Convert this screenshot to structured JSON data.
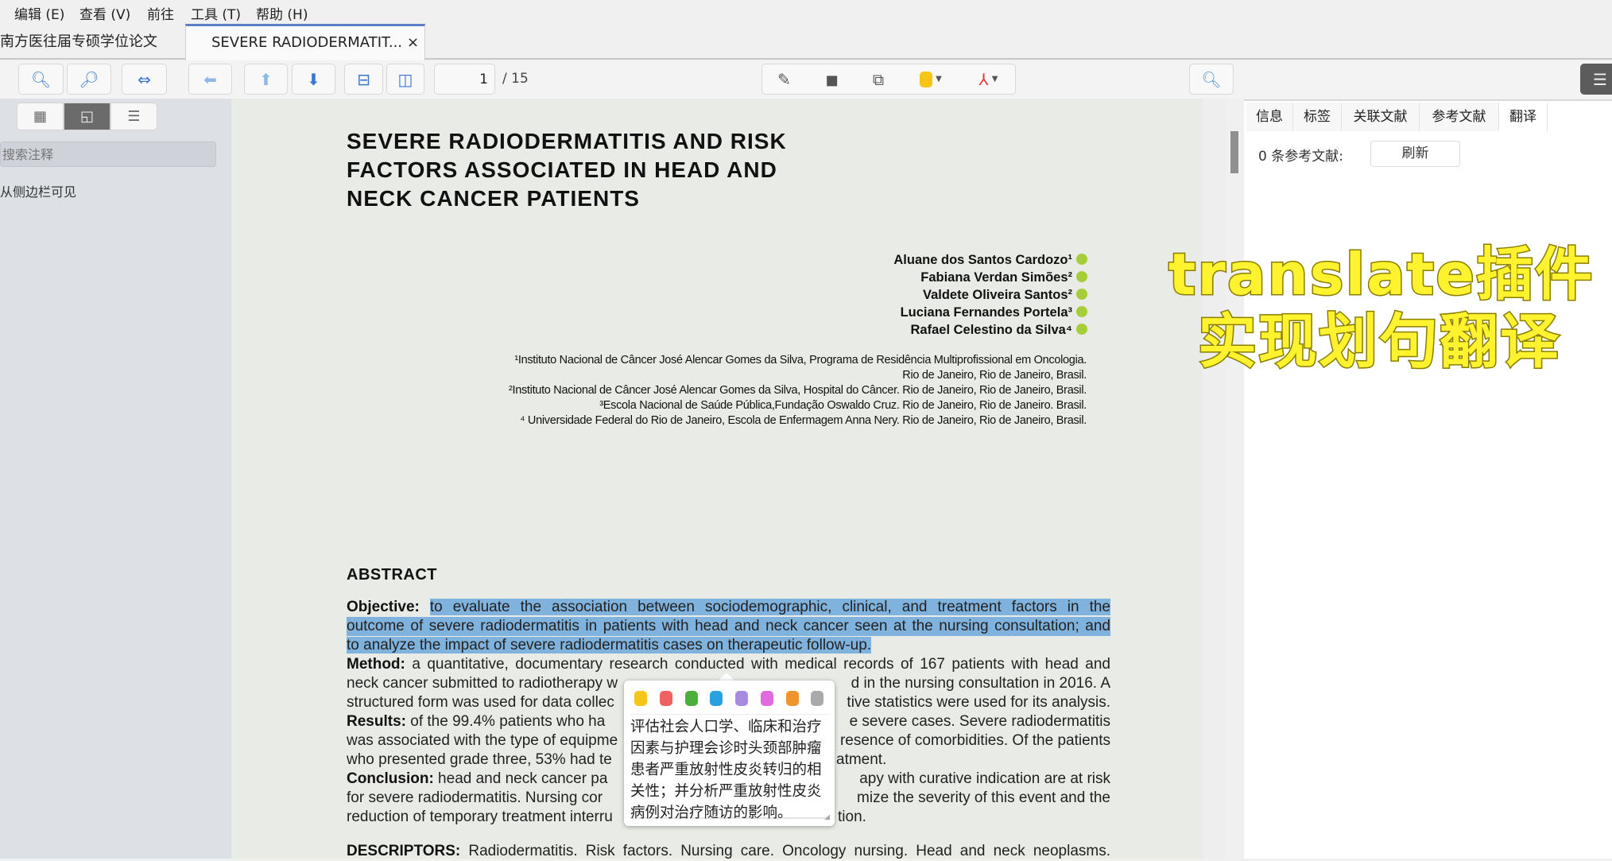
{
  "menubar": {
    "items": [
      "编辑 (E)",
      "查看 (V)",
      "前往",
      "工具 (T)",
      "帮助 (H)"
    ]
  },
  "tabs": [
    {
      "label": "南方医往届专硕学位论文"
    },
    {
      "label": "SEVERE RADIODERMATIT...",
      "close": "×"
    }
  ],
  "toolbar": {
    "page_current": "1",
    "page_total": "/ 15",
    "highlight_color": "#f5c518"
  },
  "sidebar": {
    "search_placeholder": "搜索注释",
    "note": "从侧边栏可见"
  },
  "right_panel": {
    "tabs": [
      "信息",
      "标签",
      "关联文献",
      "参考文献",
      "翻译"
    ],
    "ref_count": "0 条参考文献:",
    "refresh": "刷新"
  },
  "document": {
    "title_lines": [
      "SEVERE RADIODERMATITIS AND RISK",
      "FACTORS ASSOCIATED IN HEAD AND",
      "NECK CANCER PATIENTS"
    ],
    "authors": [
      "Aluane dos Santos Cardozo¹",
      "Fabiana Verdan Simões²",
      "Valdete Oliveira Santos²",
      "Luciana Fernandes Portela³",
      "Rafael Celestino da Silva⁴"
    ],
    "affiliations": [
      "¹Instituto Nacional de Câncer José Alencar Gomes da Silva, Programa de Residência Multiprofissional em Oncologia.",
      "Rio de Janeiro, Rio de Janeiro, Brasil.",
      "²Instituto Nacional de Câncer José Alencar Gomes da Silva, Hospital do Câncer. Rio de Janeiro, Rio de Janeiro, Brasil.",
      "³Escola Nacional de Saúde Pública,Fundação Oswaldo Cruz. Rio de Janeiro, Rio de Janeiro. Brasil.",
      "⁴ Universidade Federal do Rio de Janeiro, Escola de Enfermagem Anna Nery. Rio de Janeiro, Rio de Janeiro, Brasil."
    ],
    "abstract_heading": "ABSTRACT",
    "objective_label": "Objective:",
    "objective_lines": [
      "to evaluate the association between sociodemographic, clinical, and treatment factors in the",
      "outcome of severe radiodermatitis in patients with head and neck cancer seen at the nursing consultation; and",
      "to analyze the impact of severe radiodermatitis cases on therapeutic follow-up."
    ],
    "method_label": "Method:",
    "method_line1": "a quantitative, documentary research conducted with medical records of 167 patients with head and",
    "lines": [
      {
        "left": "neck cancer submitted to radiotherapy w",
        "right": "d in the nursing consultation in 2016. A"
      },
      {
        "left": "structured form was used for data collec",
        "right": "tive statistics were used for its analysis."
      },
      {
        "label": "Results:",
        "left": " of the 99.4% patients who ha",
        "right": "e severe cases. Severe radiodermatitis"
      },
      {
        "left": "was associated with the type of equipme",
        "right": "resence of comorbidities. Of the patients"
      },
      {
        "left": "who presented grade three, 53% had te",
        "right": "atment."
      },
      {
        "label": "Conclusion:",
        "left": " head and neck cancer pa",
        "right": "apy with curative indication are at risk"
      },
      {
        "left": "for severe radiodermatitis. Nursing cor",
        "right": "mize the severity of this event and the"
      },
      {
        "left": "reduction of temporary treatment interru",
        "right": "tion."
      }
    ],
    "descriptors_label": "DESCRIPTORS:",
    "descriptors": " Radiodermatitis. Risk factors. Nursing care. Oncology nursing. Head and neck neoplasms."
  },
  "popup": {
    "colors": [
      "#f5c518",
      "#f06262",
      "#4caf3c",
      "#29a0e0",
      "#a68be0",
      "#e06be0",
      "#f0952e",
      "#aaaaaa"
    ],
    "translation": "评估社会人口学、临床和治疗因素与护理会诊时头颈部肿瘤患者严重放射性皮炎转归的相关性；并分析严重放射性皮炎病例对治疗随访的影响。"
  },
  "overlay": {
    "line1": "translate插件",
    "line2": "实现划句翻译"
  }
}
